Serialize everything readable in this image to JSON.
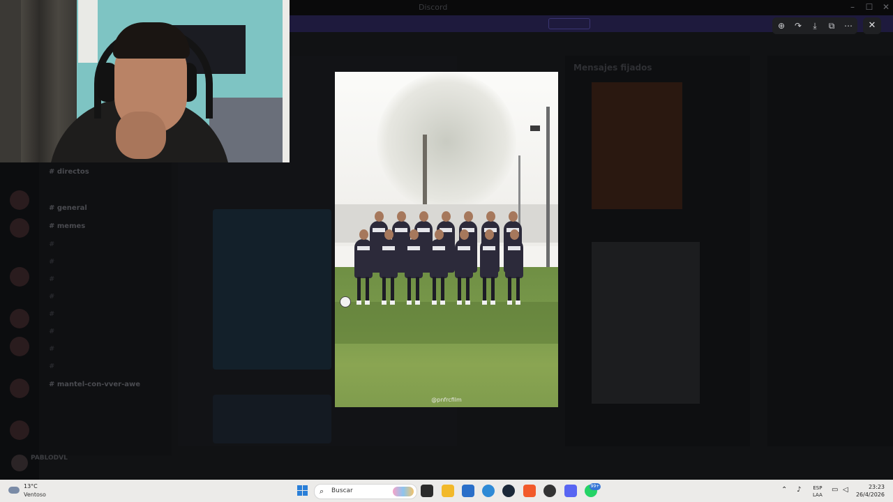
{
  "window": {
    "title": "Discord",
    "controls": [
      "–",
      "☐",
      "✕"
    ]
  },
  "banner": {
    "text": "",
    "button_label": ""
  },
  "lightbox": {
    "watermark": "@pnfrcfilm",
    "toolbar": [
      {
        "name": "zoom-icon",
        "glyph": "⊕"
      },
      {
        "name": "share-icon",
        "glyph": "↷"
      },
      {
        "name": "download-icon",
        "glyph": "⤓"
      },
      {
        "name": "open-external-icon",
        "glyph": "⧉"
      },
      {
        "name": "more-icon",
        "glyph": "⋯"
      }
    ],
    "close_glyph": "✕"
  },
  "discord_bg": {
    "pinned_title": "Mensajes fijados",
    "user_name": "PABLODVL",
    "user_status": "",
    "channels": [
      {
        "label": "# directos",
        "bright": true
      },
      {
        "label": "# general",
        "bright": true
      },
      {
        "label": "# memes",
        "bright": true
      },
      {
        "label": "#",
        "bright": false
      },
      {
        "label": "#",
        "bright": false
      },
      {
        "label": "#",
        "bright": false
      },
      {
        "label": "#",
        "bright": false
      },
      {
        "label": "#",
        "bright": false
      },
      {
        "label": "#",
        "bright": false
      },
      {
        "label": "#",
        "bright": false
      },
      {
        "label": "#",
        "bright": false
      },
      {
        "label": "# mantel-con-vver-awe",
        "bright": true
      }
    ]
  },
  "taskbar": {
    "weather_temp": "13°C",
    "weather_cond": "Ventoso",
    "search_placeholder": "Buscar",
    "lang_top": "ESP",
    "lang_bottom": "LAA",
    "time": "23:23",
    "date": "26/4/2026",
    "badge_count": "99+"
  },
  "colors": {
    "accent": "#5865f2",
    "taskbar_bg": "#ecebe9",
    "overlay_bg": "#0b0c0e"
  }
}
